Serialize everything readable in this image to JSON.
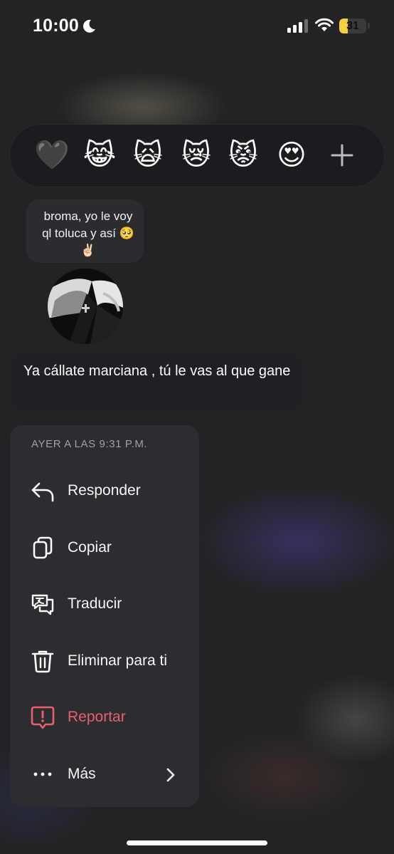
{
  "status_bar": {
    "time": "10:00",
    "battery_level": "31",
    "battery_fraction": 0.31,
    "icons": [
      "moon-icon",
      "cellular-signal-icon",
      "wifi-icon",
      "battery-icon"
    ]
  },
  "reactions": [
    {
      "name": "black-heart",
      "emoji": "🖤"
    },
    {
      "name": "cat-tears-of-joy",
      "emoji": "😹"
    },
    {
      "name": "weary-cat",
      "emoji": "🙀"
    },
    {
      "name": "crying-cat",
      "emoji": "😿"
    },
    {
      "name": "pouting-cat",
      "emoji": "😾"
    },
    {
      "name": "heart-eyes",
      "emoji": "😍"
    }
  ],
  "reaction_more_icon": "plus-icon",
  "messages": {
    "quoted_reply": "broma, yo le voy ql toluca y así 🥺✌🏻",
    "selected": "Ya cállate marciana , tú le vas al que gane"
  },
  "context_menu": {
    "header": "AYER A LAS 9:31 P.M.",
    "items": [
      {
        "label": "Responder",
        "icon": "reply-icon"
      },
      {
        "label": "Copiar",
        "icon": "copy-icon"
      },
      {
        "label": "Traducir",
        "icon": "translate-icon"
      },
      {
        "label": "Eliminar para ti",
        "icon": "trash-icon"
      },
      {
        "label": "Reportar",
        "icon": "report-icon",
        "color": "#e8606d"
      },
      {
        "label": "Más",
        "icon": "more-icon"
      }
    ]
  },
  "colors": {
    "background": "#232325",
    "menu_background": "#2c2d30",
    "danger": "#e8606d",
    "battery": "#f4d23e"
  }
}
